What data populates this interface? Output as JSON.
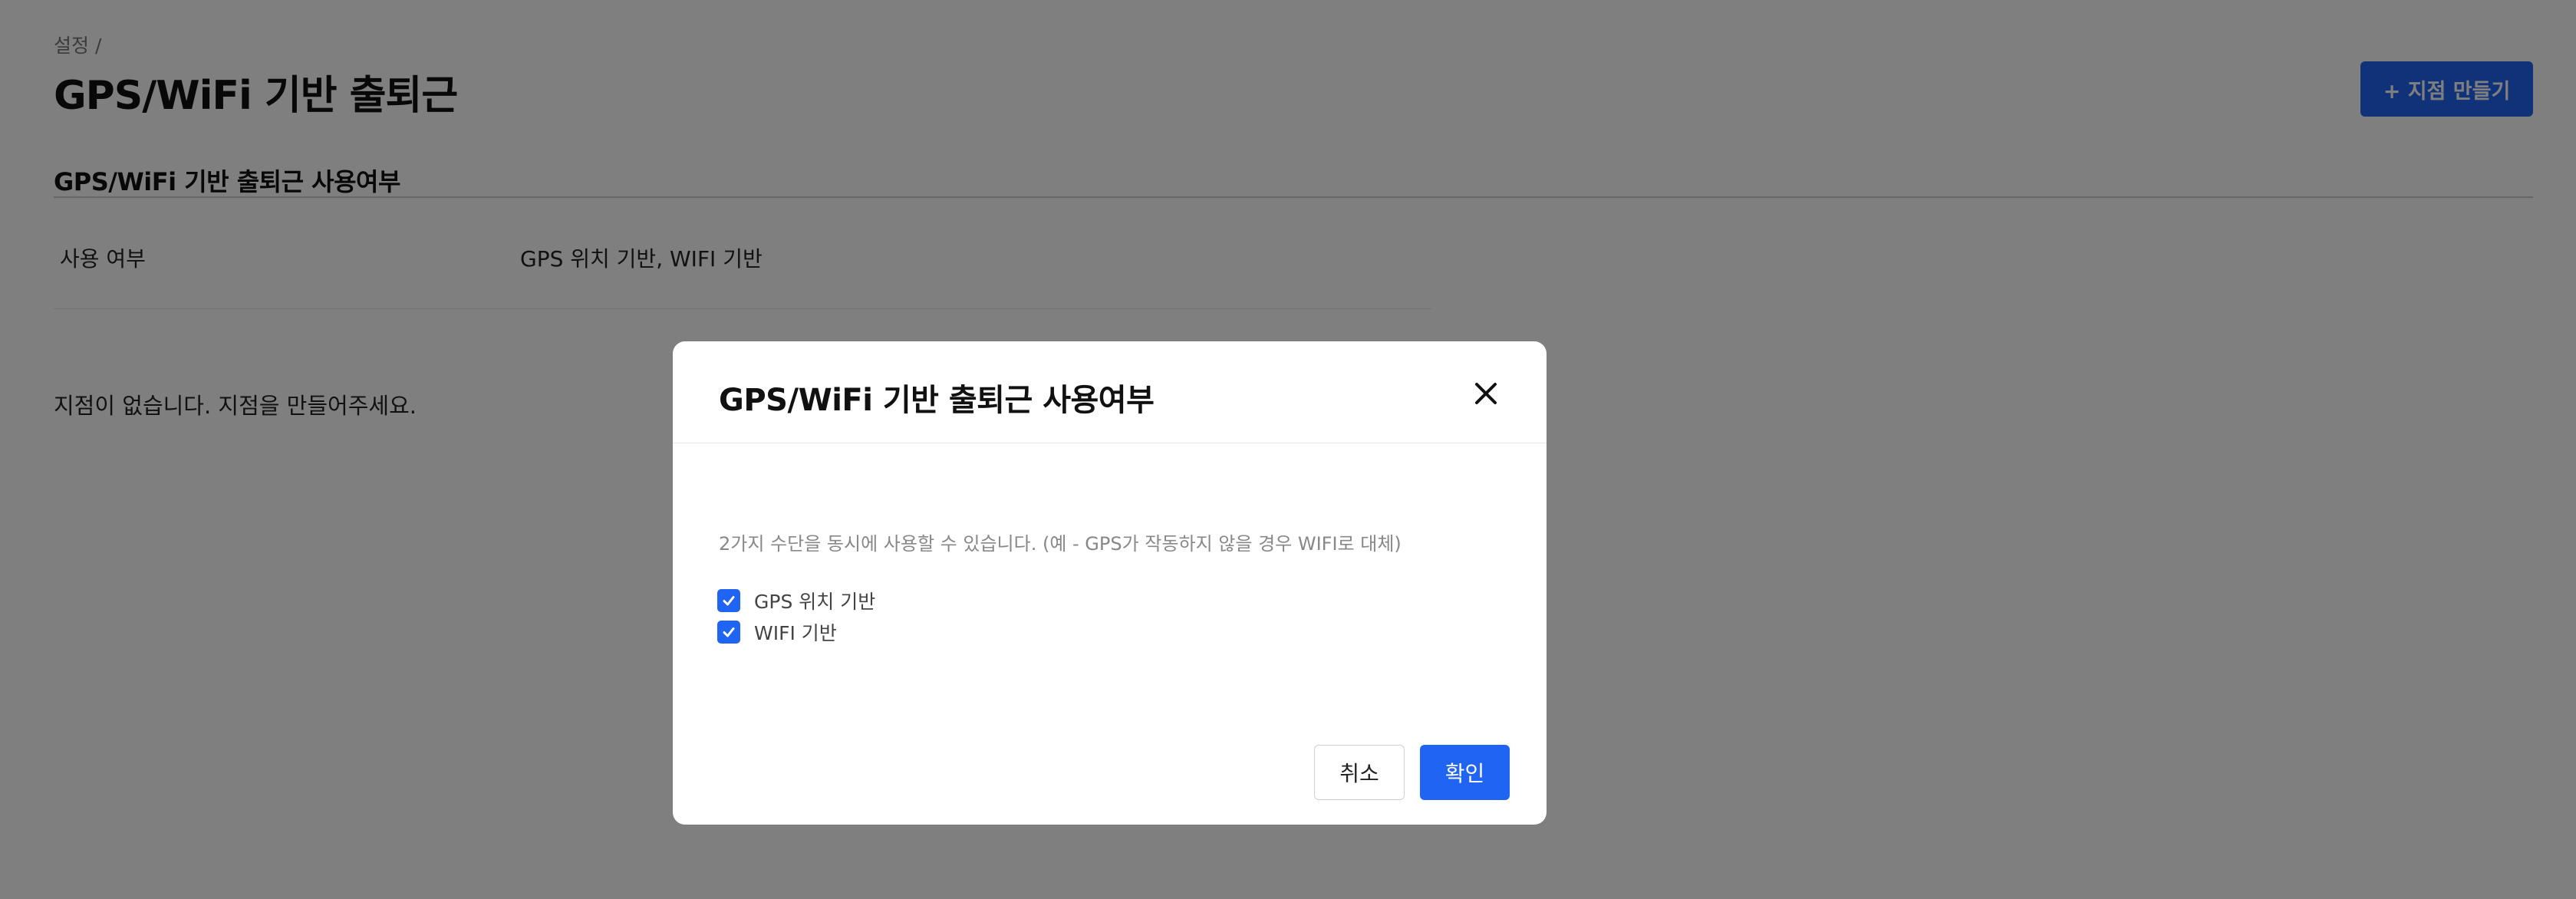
{
  "breadcrumb": "설정 /",
  "page_title": "GPS/WiFi 기반 출퇴근",
  "create_button": "+ 지점 만들기",
  "section": {
    "title": "GPS/WiFi 기반 출퇴근 사용여부",
    "row_label": "사용 여부",
    "row_value": "GPS 위치 기반, WIFI 기반"
  },
  "empty_message": "지점이 없습니다. 지점을 만들어주세요.",
  "modal": {
    "title": "GPS/WiFi 기반 출퇴근 사용여부",
    "description": "2가지 수단을 동시에 사용할 수 있습니다. (예 - GPS가 작동하지 않을 경우 WIFI로 대체)",
    "options": [
      {
        "label": "GPS 위치 기반",
        "checked": true
      },
      {
        "label": "WIFI 기반",
        "checked": true
      }
    ],
    "cancel_label": "취소",
    "confirm_label": "확인"
  },
  "colors": {
    "primary": "#1f64f2",
    "overlay": "rgba(0,0,0,0.5)"
  },
  "icons": {
    "close": "close-icon",
    "check": "check-icon"
  }
}
